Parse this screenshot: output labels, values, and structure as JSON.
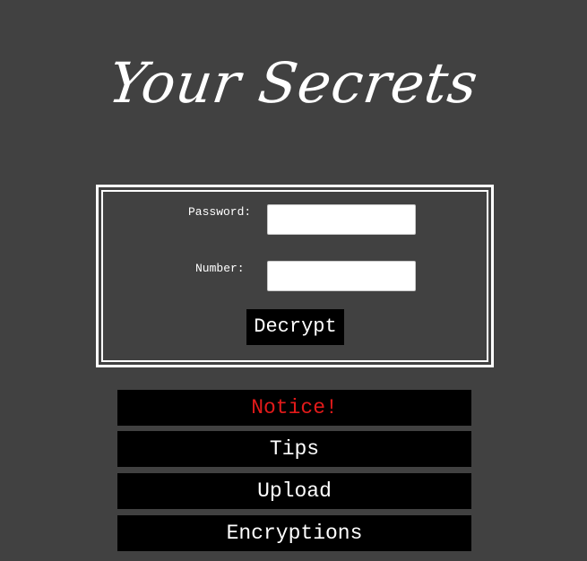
{
  "header": {
    "title": "Your Secrets"
  },
  "form": {
    "password_label": "Password:",
    "password_value": "",
    "password_placeholder": "",
    "number_label": "Number:",
    "number_value": "",
    "number_placeholder": "",
    "decrypt_label": "Decrypt"
  },
  "menu": {
    "items": [
      {
        "label": "Notice!",
        "color": "#e21a1a"
      },
      {
        "label": "Tips",
        "color": "#ffffff"
      },
      {
        "label": "Upload",
        "color": "#ffffff"
      },
      {
        "label": "Encryptions",
        "color": "#ffffff"
      }
    ]
  },
  "colors": {
    "background": "#414141",
    "button_bg": "#000000",
    "text": "#ffffff",
    "notice": "#e21a1a"
  }
}
